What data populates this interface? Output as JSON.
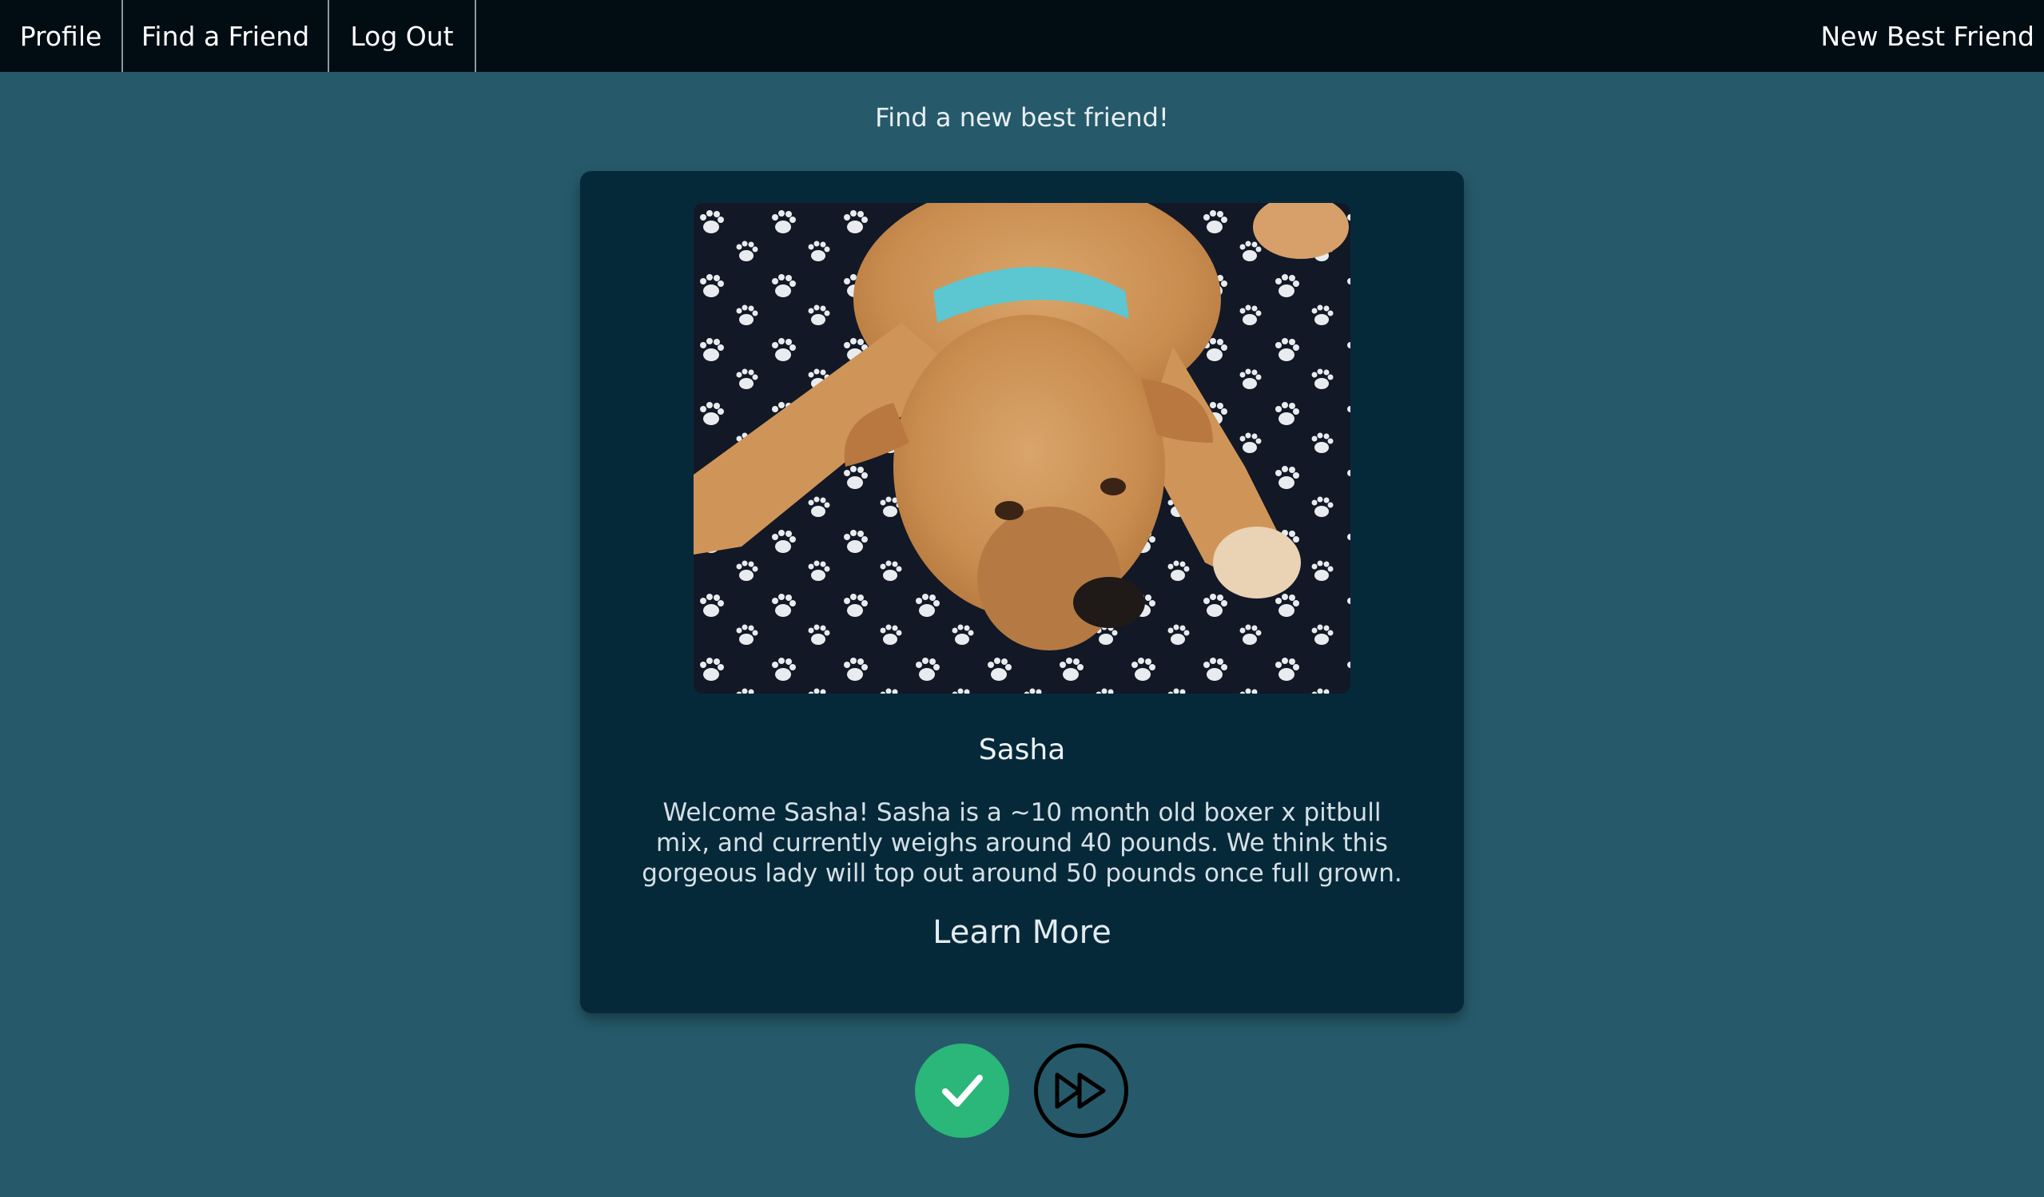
{
  "nav": {
    "items": [
      {
        "label": "Profile"
      },
      {
        "label": "Find a Friend"
      },
      {
        "label": "Log Out"
      }
    ],
    "brand": "New Best Friend"
  },
  "page": {
    "heading": "Find a new best friend!"
  },
  "card": {
    "name": "Sasha",
    "description": "Welcome Sasha! Sasha is a ~10 month old boxer x pitbull mix, and currently weighs around 40 pounds. We think this gorgeous lady will top out around 50 pounds once full grown.",
    "learn_more": "Learn More"
  },
  "actions": {
    "accept_icon": "checkmark-icon",
    "skip_icon": "fast-forward-icon",
    "accept_color": "#2bb67a"
  },
  "colors": {
    "background": "#265a6a",
    "navbar": "#010d13",
    "card": "#06293a"
  }
}
